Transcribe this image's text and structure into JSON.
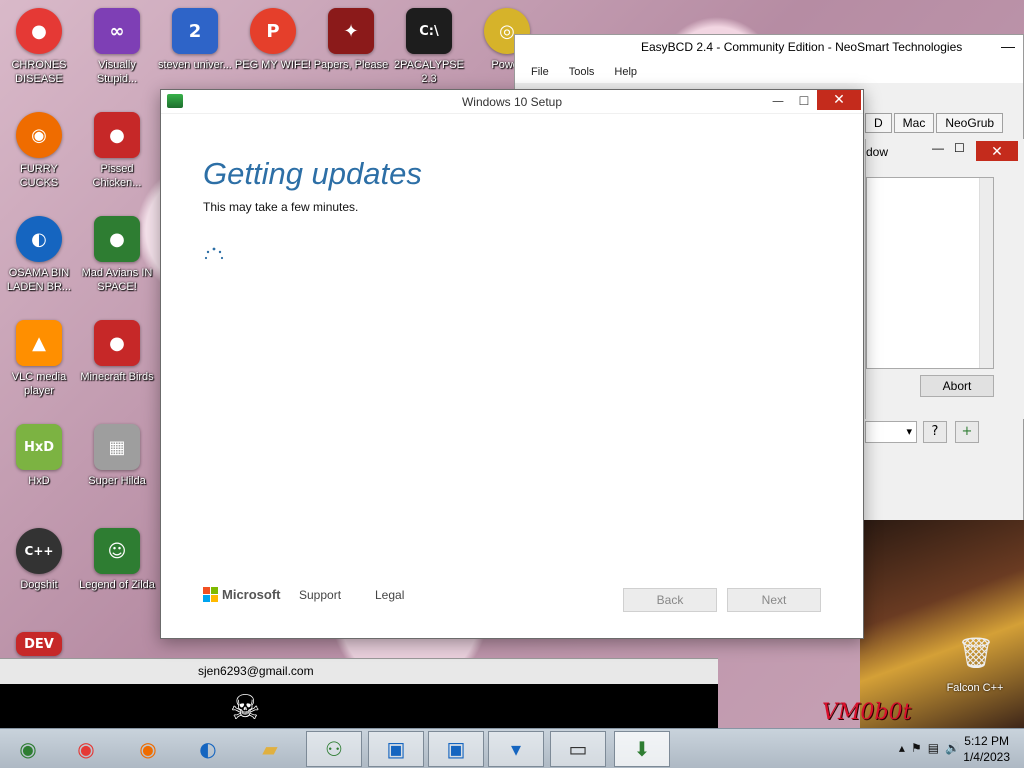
{
  "desktop": {
    "icons": [
      {
        "label": "CHRONES DISEASE",
        "glyph": "●",
        "color": "#e53935"
      },
      {
        "label": "Visually Stupid...",
        "glyph": "∞",
        "color": "#7e3fb5"
      },
      {
        "label": "steven univer...",
        "glyph": "2",
        "color": "#2e64c8"
      },
      {
        "label": "PEG MY WIFE!",
        "glyph": "P",
        "color": "#e53f2b"
      },
      {
        "label": "Papers, Please",
        "glyph": "✦",
        "color": "#8b1a1a"
      },
      {
        "label": "2PACALYPSE 2.3",
        "glyph": "C:\\",
        "color": "#1d1d1d"
      },
      {
        "label": "Power",
        "glyph": "◎",
        "color": "#d6b32a"
      },
      {
        "label": "FURRY CUCKS",
        "glyph": "◉",
        "color": "#ef6c00"
      },
      {
        "label": "Pissed Chicken...",
        "glyph": "●",
        "color": "#c62828"
      },
      {
        "label": "OSAMA BIN LADEN BR...",
        "glyph": "◐",
        "color": "#1565c0"
      },
      {
        "label": "Mad Avians IN SPACE!",
        "glyph": "●",
        "color": "#2e7d32"
      },
      {
        "label": "VLC media player",
        "glyph": "▲",
        "color": "#ff8f00"
      },
      {
        "label": "Minecraft Birds",
        "glyph": "●",
        "color": "#c62828"
      },
      {
        "label": "HxD",
        "glyph": "HxD",
        "color": "#7cb342"
      },
      {
        "label": "Super Hilda",
        "glyph": "▦",
        "color": "#9e9e9e"
      },
      {
        "label": "Dogshit",
        "glyph": "C++",
        "color": "#333333"
      },
      {
        "label": "Legend of Zilda",
        "glyph": "☺",
        "color": "#2e7d32"
      },
      {
        "label": "DEV",
        "glyph": "DEV",
        "color": "#c62828"
      }
    ],
    "recycle_bin_label": "Falcon C++",
    "email_text": "sjen6293@gmail.com",
    "overlay_text": "VM0b0t"
  },
  "easybcd": {
    "title": "EasyBCD 2.4 - Community Edition - NeoSmart Technologies",
    "menu": [
      "File",
      "Tools",
      "Help"
    ],
    "tabs": [
      "D",
      "Mac",
      "NeoGrub"
    ],
    "inner_title": "dow",
    "abort_label": "Abort"
  },
  "setup": {
    "window_title": "Windows 10 Setup",
    "heading": "Getting updates",
    "subtitle": "This may take a few minutes.",
    "brand": "Microsoft",
    "support_link": "Support",
    "legal_link": "Legal",
    "back_label": "Back",
    "next_label": "Next"
  },
  "taskbar": {
    "items": [
      "chrome-launcher",
      "chrome",
      "firefox",
      "obama",
      "folder",
      "network-users",
      "remote-desktop-1",
      "remote-desktop-2",
      "recycle",
      "computer",
      "setup"
    ],
    "time": "5:12 PM",
    "date": "1/4/2023"
  },
  "colors": {
    "heading_blue": "#2d6fa6",
    "close_red": "#c42b1c",
    "taskbar": "#b9c4ce"
  }
}
